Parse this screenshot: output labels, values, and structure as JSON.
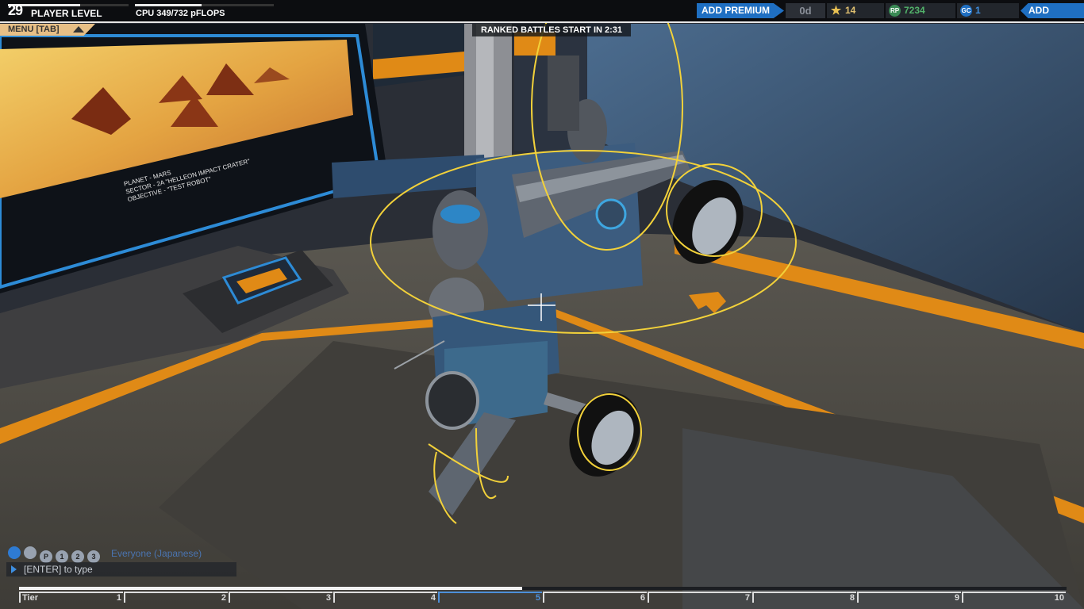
{
  "header": {
    "player_level": "29",
    "player_level_label": "PLAYER LEVEL",
    "player_level_progress": 0.6,
    "cpu_label": "CPU 349/732 pFLOPS",
    "cpu_progress": 0.48,
    "add_premium_label": "ADD PREMIUM",
    "premium_days": "0d",
    "stars": "14",
    "robits": "7234",
    "galaxy_credits": "1",
    "add_funds_label": "ADD FUNDS"
  },
  "menu_tab_label": "MENU [TAB]",
  "ranked_banner": "RANKED BATTLES START IN 2:31",
  "screen_info": {
    "planet": "PLANET - MARS",
    "sector": "SECTOR - 2A \"HELLEON IMPACT CRATER\"",
    "objective": "OBJECTIVE - \"TEST ROBOT\""
  },
  "chat": {
    "channel_icons": [
      "globe-icon",
      "people-icon",
      "p-icon",
      "user1-icon",
      "user2-icon",
      "user3-icon"
    ],
    "channel_icon_labels": [
      "",
      "",
      "P",
      "1",
      "2",
      "3"
    ],
    "channel": "Everyone (Japanese)",
    "input_hint": "[ENTER] to type"
  },
  "tier_bar": {
    "label": "Tier",
    "ticks": [
      "1",
      "2",
      "3",
      "4",
      "5",
      "6",
      "7",
      "8",
      "9",
      "10"
    ],
    "current_tier": "5",
    "progress": 0.48
  },
  "colors": {
    "accent_orange": "#e08a16",
    "highlight_yellow": "#f2d13a",
    "ui_blue": "#1f6fc2"
  }
}
